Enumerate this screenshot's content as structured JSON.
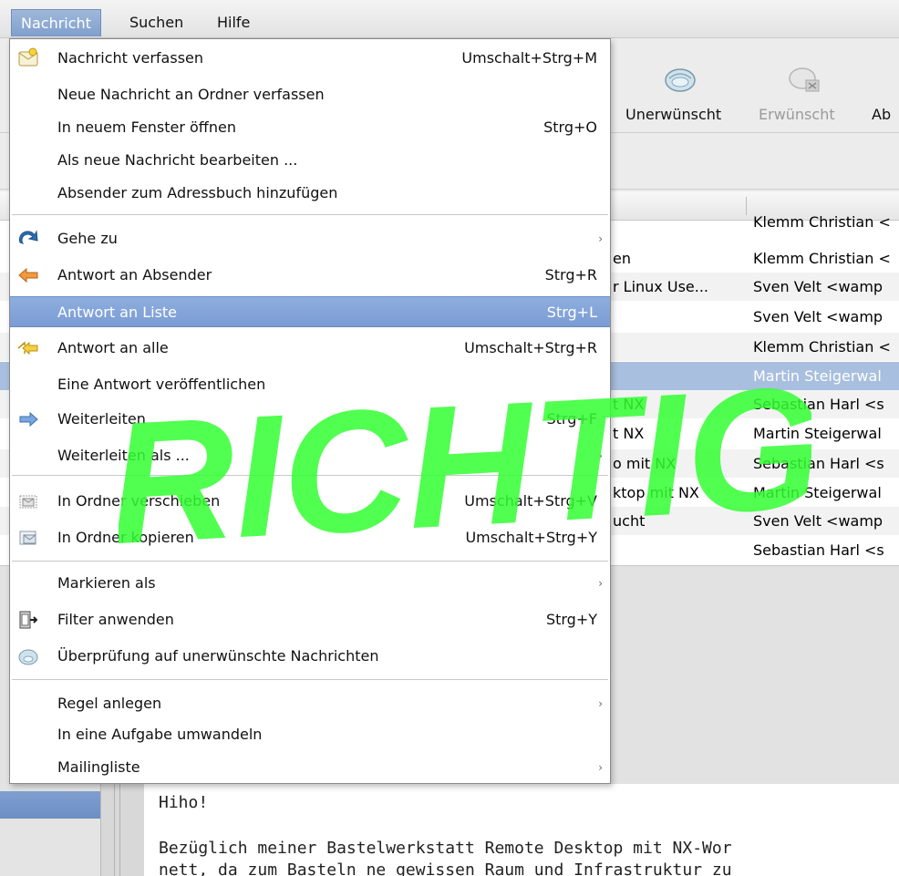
{
  "menubar": {
    "items": [
      {
        "label": "Nachricht",
        "active": true
      },
      {
        "label": "Suchen"
      },
      {
        "label": "Hilfe"
      }
    ]
  },
  "toolbar": {
    "junk_label": "Unerwünscht",
    "notjunk_label": "Erwünscht",
    "abort_label": "Ab"
  },
  "messages": [
    {
      "subject": "",
      "from": "Klemm Christian <"
    },
    {
      "subject": "en",
      "from": "Klemm Christian <"
    },
    {
      "subject": "r Linux Use...",
      "from": "Sven Velt <wamp"
    },
    {
      "subject": "",
      "from": "Sven Velt <wamp"
    },
    {
      "subject": "",
      "from": "Klemm Christian <"
    },
    {
      "subject": "",
      "from": "Martin Steigerwal",
      "selected": true
    },
    {
      "subject": "t NX",
      "from": "Sebastian Harl <s"
    },
    {
      "subject": "t NX",
      "from": "Martin Steigerwal"
    },
    {
      "subject": "o mit NX",
      "from": "Sebastian Harl <s"
    },
    {
      "subject": "ktop mit NX",
      "from": "Martin Steigerwal"
    },
    {
      "subject": "ucht",
      "from": "Sven Velt <wamp"
    },
    {
      "subject": "",
      "from": "Sebastian Harl <s"
    }
  ],
  "preview": {
    "line1": "Hiho!",
    "line2": "Bezüglich meiner Bastelwerkstatt Remote Desktop mit NX-Wor",
    "line3": "nett, da zum Basteln ne gewissen Raum und Infrastruktur zu"
  },
  "menu": {
    "items": [
      {
        "label": "Nachricht verfassen",
        "shortcut": "Umschalt+Strg+M",
        "icon": "compose-icon"
      },
      {
        "label": "Neue Nachricht an Ordner verfassen",
        "shortcut": ""
      },
      {
        "label": "In neuem Fenster öffnen",
        "shortcut": "Strg+O"
      },
      {
        "label": "Als neue Nachricht bearbeiten ...",
        "shortcut": ""
      },
      {
        "label": "Absender zum Adressbuch hinzufügen",
        "shortcut": ""
      },
      {
        "label": "Gehe zu",
        "shortcut": "",
        "submenu": true,
        "icon": "go-to-icon"
      },
      {
        "label": "Antwort an Absender",
        "shortcut": "Strg+R",
        "icon": "reply-icon"
      },
      {
        "label": "Antwort an Liste",
        "shortcut": "Strg+L",
        "highlighted": true
      },
      {
        "label": "Antwort an alle",
        "shortcut": "Umschalt+Strg+R",
        "icon": "reply-all-icon"
      },
      {
        "label": "Eine Antwort veröffentlichen",
        "shortcut": ""
      },
      {
        "label": "Weiterleiten",
        "shortcut": "Strg+F",
        "icon": "forward-icon"
      },
      {
        "label": "Weiterleiten als ...",
        "shortcut": "",
        "submenu": true
      },
      {
        "label": "In Ordner verschieben",
        "shortcut": "Umschalt+Strg+V",
        "icon": "move-folder-icon"
      },
      {
        "label": "In Ordner kopieren",
        "shortcut": "Umschalt+Strg+Y",
        "icon": "copy-folder-icon"
      },
      {
        "label": "Markieren als",
        "shortcut": "",
        "submenu": true
      },
      {
        "label": "Filter anwenden",
        "shortcut": "Strg+Y",
        "icon": "filter-icon"
      },
      {
        "label": "Überprüfung auf unerwünschte Nachrichten",
        "shortcut": "",
        "icon": "junk-check-icon"
      },
      {
        "label": "Regel anlegen",
        "shortcut": "",
        "submenu": true
      },
      {
        "label": "In eine Aufgabe umwandeln",
        "shortcut": ""
      },
      {
        "label": "Mailingliste",
        "shortcut": "",
        "submenu": true
      }
    ]
  },
  "watermark": {
    "text": "RICHTIG",
    "color": "#33ff33"
  },
  "colors": {
    "highlight": "#7b9cd3",
    "selected_row": "#a8bfdf"
  }
}
